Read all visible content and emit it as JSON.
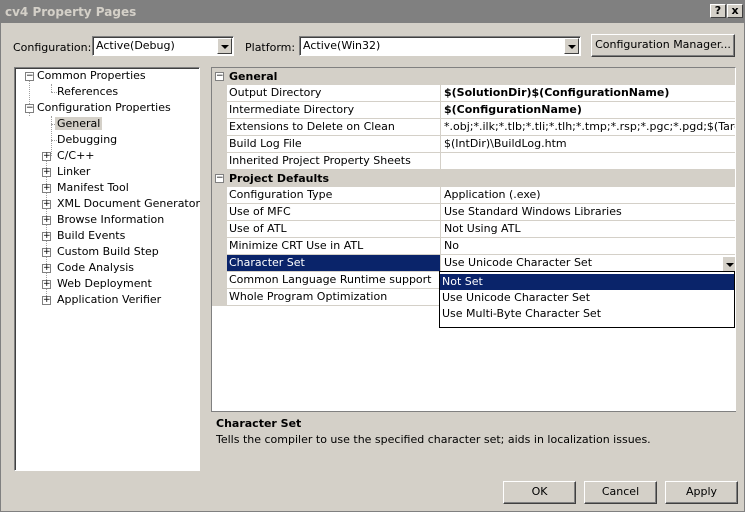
{
  "window": {
    "title": "cv4 Property Pages",
    "help_button": "?",
    "close_button": "x"
  },
  "toolbar": {
    "configuration_label": "Configuration:",
    "configuration_value": "Active(Debug)",
    "platform_label": "Platform:",
    "platform_value": "Active(Win32)",
    "config_manager_button": "Configuration Manager..."
  },
  "tree": {
    "items": [
      {
        "label": "Common Properties",
        "expander": "−"
      },
      {
        "label": "References"
      },
      {
        "label": "Configuration Properties",
        "expander": "−"
      },
      {
        "label": "General",
        "selected": true
      },
      {
        "label": "Debugging"
      },
      {
        "label": "C/C++",
        "expander": "+"
      },
      {
        "label": "Linker",
        "expander": "+"
      },
      {
        "label": "Manifest Tool",
        "expander": "+"
      },
      {
        "label": "XML Document Generator",
        "expander": "+"
      },
      {
        "label": "Browse Information",
        "expander": "+"
      },
      {
        "label": "Build Events",
        "expander": "+"
      },
      {
        "label": "Custom Build Step",
        "expander": "+"
      },
      {
        "label": "Code Analysis",
        "expander": "+"
      },
      {
        "label": "Web Deployment",
        "expander": "+"
      },
      {
        "label": "Application Verifier",
        "expander": "+"
      }
    ]
  },
  "grid": {
    "general": {
      "category": "General",
      "expander": "−",
      "rows": [
        {
          "name": "Output Directory",
          "value": "$(SolutionDir)$(ConfigurationName)",
          "bold": true
        },
        {
          "name": "Intermediate Directory",
          "value": "$(ConfigurationName)",
          "bold": true
        },
        {
          "name": "Extensions to Delete on Clean",
          "value": "*.obj;*.ilk;*.tlb;*.tli;*.tlh;*.tmp;*.rsp;*.pgc;*.pgd;$(Target"
        },
        {
          "name": "Build Log File",
          "value": "$(IntDir)\\BuildLog.htm"
        },
        {
          "name": "Inherited Project Property Sheets",
          "value": ""
        }
      ]
    },
    "defaults": {
      "category": "Project Defaults",
      "expander": "−",
      "rows": [
        {
          "name": "Configuration Type",
          "value": "Application (.exe)"
        },
        {
          "name": "Use of MFC",
          "value": "Use Standard Windows Libraries"
        },
        {
          "name": "Use of ATL",
          "value": "Not Using ATL"
        },
        {
          "name": "Minimize CRT Use in ATL",
          "value": "No"
        },
        {
          "name": "Character Set",
          "value": "Use Unicode Character Set",
          "selected": true
        },
        {
          "name": "Common Language Runtime support",
          "value": ""
        },
        {
          "name": "Whole Program Optimization",
          "value": ""
        }
      ]
    },
    "dropdown_options": [
      "Not Set",
      "Use Unicode Character Set",
      "Use Multi-Byte Character Set"
    ]
  },
  "description": {
    "title": "Character Set",
    "text": "Tells the compiler to use the specified character set; aids in localization issues."
  },
  "buttons": {
    "ok": "OK",
    "cancel": "Cancel",
    "apply": "Apply"
  },
  "colors": {
    "face": "#d4d0c8",
    "selection": "#0a246a",
    "titlebar": "#808080"
  }
}
